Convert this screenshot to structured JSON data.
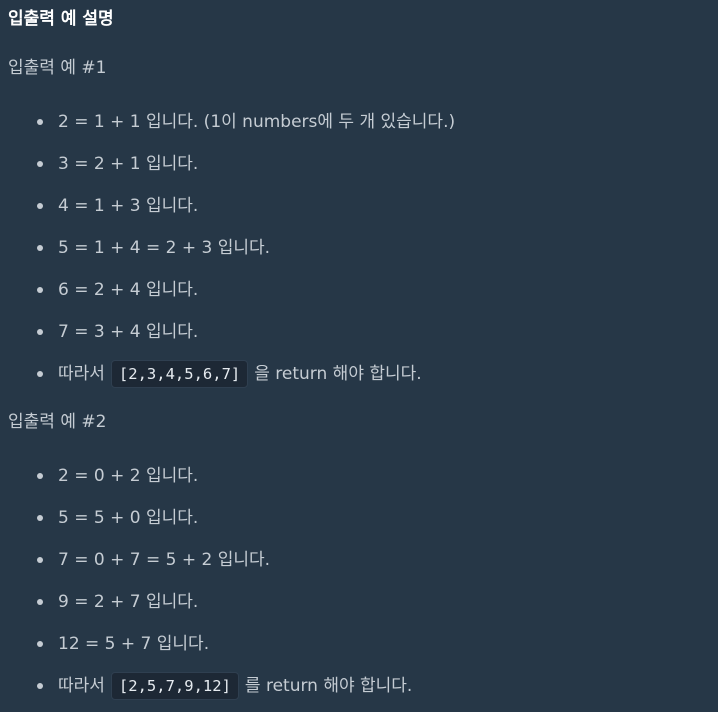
{
  "title": "입출력 예 설명",
  "examples": [
    {
      "heading": "입출력 예 #1",
      "items": [
        {
          "text": "2 = 1 + 1 입니다. (1이 numbers에 두 개 있습니다.)"
        },
        {
          "text": "3 = 2 + 1 입니다."
        },
        {
          "text": "4 = 1 + 3 입니다."
        },
        {
          "text": "5 = 1 + 4 = 2 + 3 입니다."
        },
        {
          "text": "6 = 2 + 4 입니다."
        },
        {
          "text": "7 = 3 + 4 입니다."
        },
        {
          "prefix": "따라서",
          "code": "[2,3,4,5,6,7]",
          "suffix": "을 return 해야 합니다."
        }
      ]
    },
    {
      "heading": "입출력 예 #2",
      "items": [
        {
          "text": "2 = 0 + 2 입니다."
        },
        {
          "text": "5 = 5 + 0 입니다."
        },
        {
          "text": "7 = 0 + 7 = 5 + 2 입니다."
        },
        {
          "text": "9 = 2 + 7 입니다."
        },
        {
          "text": "12 = 5 + 7 입니다."
        },
        {
          "prefix": "따라서",
          "code": "[2,5,7,9,12]",
          "suffix": "를 return 해야 합니다."
        }
      ]
    }
  ]
}
